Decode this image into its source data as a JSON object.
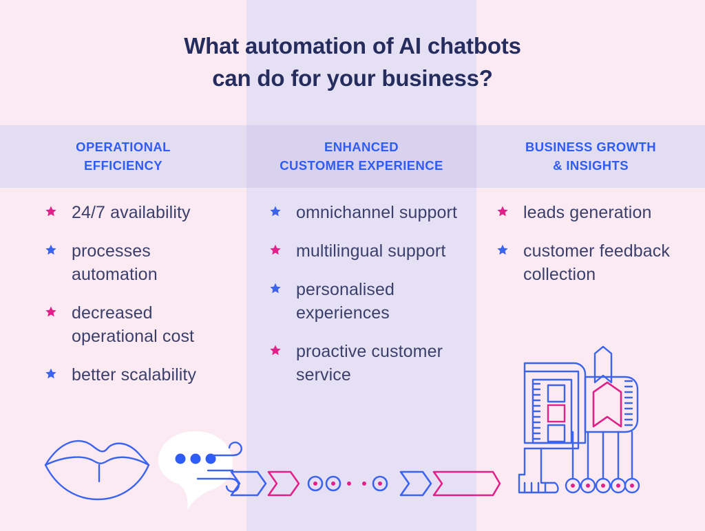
{
  "title": {
    "line1": "What automation of AI chatbots",
    "line2": "can do for your business?"
  },
  "colors": {
    "background": "#fbeaf2",
    "band_purple": "#e3ddf2",
    "band_purple_mid": "#d9d2ef",
    "column_mid": "#e6e0f4",
    "title_navy": "#252c5e",
    "heading_blue": "#2f5cf5",
    "body_text": "#3b3f6b",
    "star_pink": "#e0218a",
    "star_blue": "#3b63f0",
    "line_blue": "#3b63f0",
    "line_pink": "#e0218a"
  },
  "columns": [
    {
      "heading_line1": "OPERATIONAL",
      "heading_line2": "EFFICIENCY",
      "items": [
        {
          "text": "24/7 availability",
          "bullet_color": "pink"
        },
        {
          "text": "processes automation",
          "bullet_color": "blue"
        },
        {
          "text": "decreased operational cost",
          "bullet_color": "pink"
        },
        {
          "text": "better scalability",
          "bullet_color": "blue"
        }
      ],
      "illustration": "lips-speech-bubble-wind-icon"
    },
    {
      "heading_line1": "ENHANCED",
      "heading_line2": "CUSTOMER EXPERIENCE",
      "items": [
        {
          "text": "omnichannel support",
          "bullet_color": "blue"
        },
        {
          "text": "multilingual support",
          "bullet_color": "pink"
        },
        {
          "text": "personalised experiences",
          "bullet_color": "blue"
        },
        {
          "text": "proactive customer service",
          "bullet_color": "pink"
        }
      ],
      "illustration": "chevron-arrows-dots-icon"
    },
    {
      "heading_line1": "BUSINESS GROWTH",
      "heading_line2": "& INSIGHTS",
      "items": [
        {
          "text": "leads generation",
          "bullet_color": "pink"
        },
        {
          "text": "customer feedback collection",
          "bullet_color": "blue"
        }
      ],
      "illustration": "machine-bookmarks-icon"
    }
  ]
}
